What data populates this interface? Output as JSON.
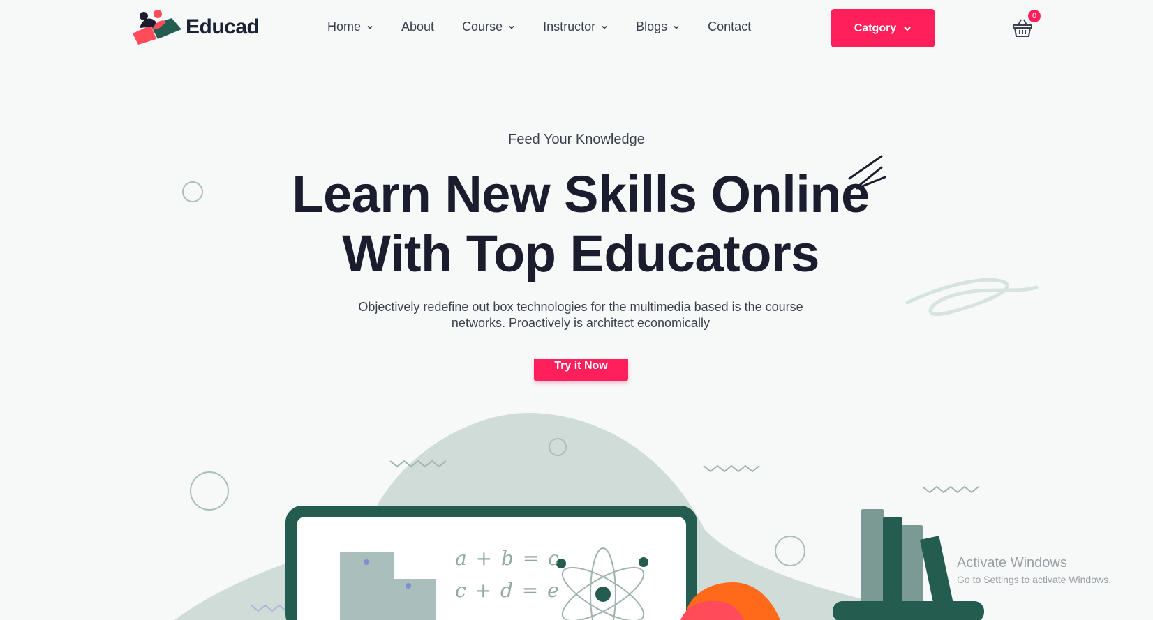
{
  "brand": {
    "name": "Educad",
    "accent_color": "#ff1f5a",
    "dark_green": "#245c4f"
  },
  "nav": {
    "items": [
      {
        "label": "Home",
        "has_dropdown": true
      },
      {
        "label": "About",
        "has_dropdown": false
      },
      {
        "label": "Course",
        "has_dropdown": true
      },
      {
        "label": "Instructor",
        "has_dropdown": true
      },
      {
        "label": "Blogs",
        "has_dropdown": true
      },
      {
        "label": "Contact",
        "has_dropdown": false
      }
    ]
  },
  "header": {
    "category_button": "Catgory",
    "cart_count": "0",
    "cart_icon": "basket-icon"
  },
  "hero": {
    "kicker": "Feed Your Knowledge",
    "title_line1": "Learn New Skills Online",
    "title_line2": "With Top Educators",
    "subtitle_line1": "Objectively redefine out box technologies for the multimedia based is the course",
    "subtitle_line2": "networks. Proactively is architect economically",
    "cta": "Try it Now"
  },
  "illustration": {
    "equation1": "a + b = c",
    "equation2": "c + d = e"
  },
  "watermark": {
    "line1": "Activate Windows",
    "line2": "Go to Settings to activate Windows."
  }
}
